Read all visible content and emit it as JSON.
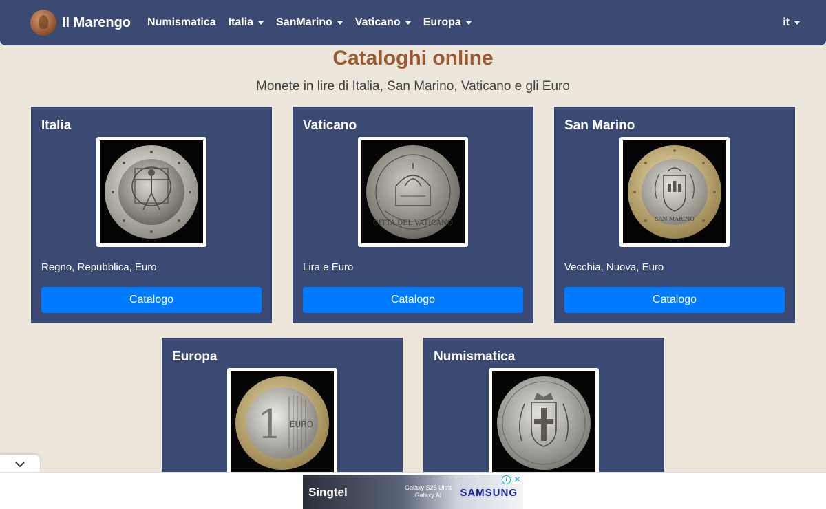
{
  "nav": {
    "brand": "Il Marengo",
    "items": [
      {
        "label": "Numismatica",
        "dropdown": false
      },
      {
        "label": "Italia",
        "dropdown": true
      },
      {
        "label": "SanMarino",
        "dropdown": true
      },
      {
        "label": "Vaticano",
        "dropdown": true
      },
      {
        "label": "Europa",
        "dropdown": true
      }
    ],
    "language": "it"
  },
  "header": {
    "title": "Cataloghi online",
    "subtitle": "Monete in lire di Italia, San Marino, Vaticano e gli Euro"
  },
  "cards": [
    {
      "title": "Italia",
      "text": "Regno, Repubblica, Euro",
      "button": "Catalogo",
      "coin_icon": "coin-italia-euro-icon"
    },
    {
      "title": "Vaticano",
      "text": "Lira e Euro",
      "button": "Catalogo",
      "coin_icon": "coin-vaticano-euro-icon"
    },
    {
      "title": "San Marino",
      "text": "Vecchia, Nuova, Euro",
      "button": "Catalogo",
      "coin_icon": "coin-sanmarino-euro-icon"
    },
    {
      "title": "Europa",
      "coin_icon": "coin-europa-euro-icon"
    },
    {
      "title": "Numismatica",
      "coin_icon": "coin-regno-lira-icon"
    }
  ],
  "ad": {
    "advertiser": "Singtel",
    "product_line1": "Galaxy S25 Ultra",
    "product_line2": "Galaxy AI",
    "brand": "SAMSUNG"
  },
  "colors": {
    "navbar": "#3a4a73",
    "background": "#ede6db",
    "title": "#9b5a33",
    "button": "#007bff"
  }
}
